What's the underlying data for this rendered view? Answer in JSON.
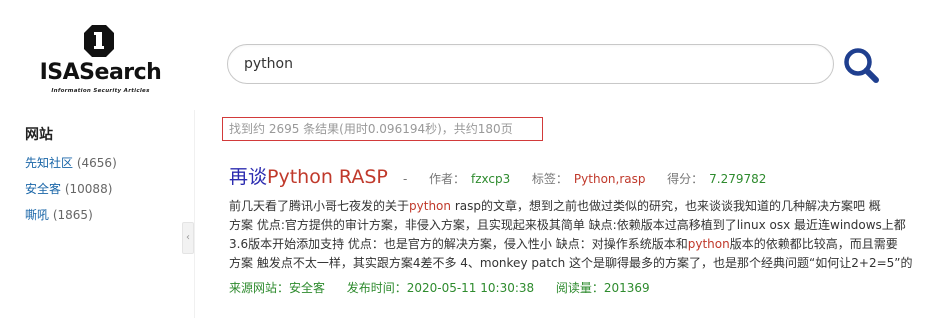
{
  "logo": {
    "text": "ISASearch",
    "subtitle": "Information Security Articles",
    "icon": "logo-mark-icon"
  },
  "search": {
    "value": "python",
    "button_icon": "search-icon"
  },
  "sidebar": {
    "title": "网站",
    "items": [
      {
        "label": "先知社区",
        "count": "(4656)"
      },
      {
        "label": "安全客",
        "count": "(10088)"
      },
      {
        "label": "嘶吼",
        "count": "(1865)"
      }
    ],
    "collapse_icon": "chevron-left-icon"
  },
  "stats": {
    "text": "找到约 2695 条结果(用时0.096194秒)，共约180页"
  },
  "result": {
    "title_prefix": "再谈",
    "title_highlight": "Python RASP",
    "separator": "-",
    "author_label": "作者：",
    "author": "fzxcp3",
    "tags_label": "标签：",
    "tags": "Python,rasp",
    "score_label": "得分：",
    "score": "7.279782",
    "snippet_lines": [
      {
        "a": "   前几天看了腾讯小哥七夜发的关于",
        "hl": "python",
        "b": " rasp的文章，想到之前也做过类似的研究，也来谈谈我知道的几种解决方案吧   概"
      },
      {
        "a": "方案 优点:官方提供的审计方案，非侵入方案，且实现起来极其简单 缺点:依赖版本过高移植到了linux osx 最近连windows上都",
        "hl": "",
        "b": ""
      },
      {
        "a": "3.6版本开始添加支持 优点：也是官方的解决方案，侵入性小 缺点：对操作系统版本和",
        "hl": "python",
        "b": "版本的依赖都比较高，而且需要"
      },
      {
        "a": "方案 触发点不太一样，其实跟方案4差不多 4、monkey patch 这个是聊得最多的方案了，也是那个经典问题“如何让2+2=5”的",
        "hl": "",
        "b": ""
      }
    ],
    "source_label": "来源网站：",
    "source": "安全客",
    "date_label": "发布时间：",
    "date": "2020-05-11 10:30:38",
    "views_label": "阅读量：",
    "views": "201369"
  },
  "colors": {
    "link_blue": "#1a66a8",
    "title_blue": "#2c2cb0",
    "highlight_red": "#c0392b",
    "meta_green": "#2e8b2e",
    "stats_border": "#d23a3a",
    "search_icon": "#1f3f8f"
  }
}
